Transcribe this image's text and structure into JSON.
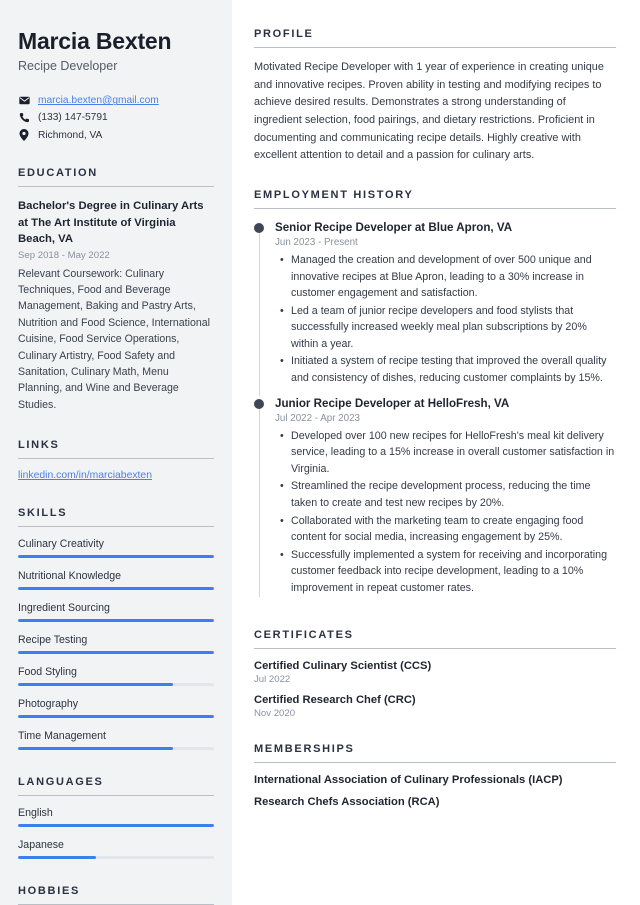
{
  "header": {
    "name": "Marcia Bexten",
    "job_title": "Recipe Developer",
    "contacts": [
      {
        "icon": "envelope-icon",
        "text": "marcia.bexten@gmail.com",
        "is_link": true
      },
      {
        "icon": "phone-icon",
        "text": "(133) 147-5791",
        "is_link": false
      },
      {
        "icon": "location-pin-icon",
        "text": "Richmond, VA",
        "is_link": false
      }
    ]
  },
  "sidebar": {
    "education": {
      "heading": "EDUCATION",
      "degree": "Bachelor's Degree in Culinary Arts at The Art Institute of Virginia Beach, VA",
      "date": "Sep 2018 - May 2022",
      "description": "Relevant Coursework: Culinary Techniques, Food and Beverage Management, Baking and Pastry Arts, Nutrition and Food Science, International Cuisine, Food Service Operations, Culinary Artistry, Food Safety and Sanitation, Culinary Math, Menu Planning, and Wine and Beverage Studies."
    },
    "links": {
      "heading": "LINKS",
      "items": [
        {
          "label": "linkedin.com/in/marciabexten"
        }
      ]
    },
    "skills": {
      "heading": "SKILLS",
      "items": [
        {
          "label": "Culinary Creativity",
          "level": 100
        },
        {
          "label": "Nutritional Knowledge",
          "level": 100
        },
        {
          "label": "Ingredient Sourcing",
          "level": 100
        },
        {
          "label": "Recipe Testing",
          "level": 100
        },
        {
          "label": "Food Styling",
          "level": 79
        },
        {
          "label": "Photography",
          "level": 100
        },
        {
          "label": "Time Management",
          "level": 79
        }
      ]
    },
    "languages": {
      "heading": "LANGUAGES",
      "items": [
        {
          "label": "English",
          "level": 100
        },
        {
          "label": "Japanese",
          "level": 40
        }
      ]
    },
    "hobbies": {
      "heading": "HOBBIES"
    }
  },
  "main": {
    "profile": {
      "heading": "PROFILE",
      "text": "Motivated Recipe Developer with 1 year of experience in creating unique and innovative recipes. Proven ability in testing and modifying recipes to achieve desired results. Demonstrates a strong understanding of ingredient selection, food pairings, and dietary restrictions. Proficient in documenting and communicating recipe details. Highly creative with excellent attention to detail and a passion for culinary arts."
    },
    "employment": {
      "heading": "EMPLOYMENT HISTORY",
      "jobs": [
        {
          "role": "Senior Recipe Developer at Blue Apron, VA",
          "date": "Jun 2023 - Present",
          "bullets": [
            "Managed the creation and development of over 500 unique and innovative recipes at Blue Apron, leading to a 30% increase in customer engagement and satisfaction.",
            "Led a team of junior recipe developers and food stylists that successfully increased weekly meal plan subscriptions by 20% within a year.",
            "Initiated a system of recipe testing that improved the overall quality and consistency of dishes, reducing customer complaints by 15%."
          ]
        },
        {
          "role": "Junior Recipe Developer at HelloFresh, VA",
          "date": "Jul 2022 - Apr 2023",
          "bullets": [
            "Developed over 100 new recipes for HelloFresh's meal kit delivery service, leading to a 15% increase in overall customer satisfaction in Virginia.",
            "Streamlined the recipe development process, reducing the time taken to create and test new recipes by 20%.",
            "Collaborated with the marketing team to create engaging food content for social media, increasing engagement by 25%.",
            "Successfully implemented a system for receiving and incorporating customer feedback into recipe development, leading to a 10% improvement in repeat customer rates."
          ]
        }
      ]
    },
    "certificates": {
      "heading": "CERTIFICATES",
      "items": [
        {
          "name": "Certified Culinary Scientist (CCS)",
          "date": "Jul 2022"
        },
        {
          "name": "Certified Research Chef (CRC)",
          "date": "Nov 2020"
        }
      ]
    },
    "memberships": {
      "heading": "MEMBERSHIPS",
      "items": [
        {
          "name": "International Association of Culinary Professionals (IACP)"
        },
        {
          "name": "Research Chefs Association (RCA)"
        }
      ]
    }
  },
  "colors": {
    "sidebar_bg": "#f1f3f5",
    "accent_blue": "#3b7ff0",
    "link_blue": "#4a7fe8",
    "heading": "#2b3141",
    "body_text": "#343b47",
    "muted": "#8a919c"
  }
}
